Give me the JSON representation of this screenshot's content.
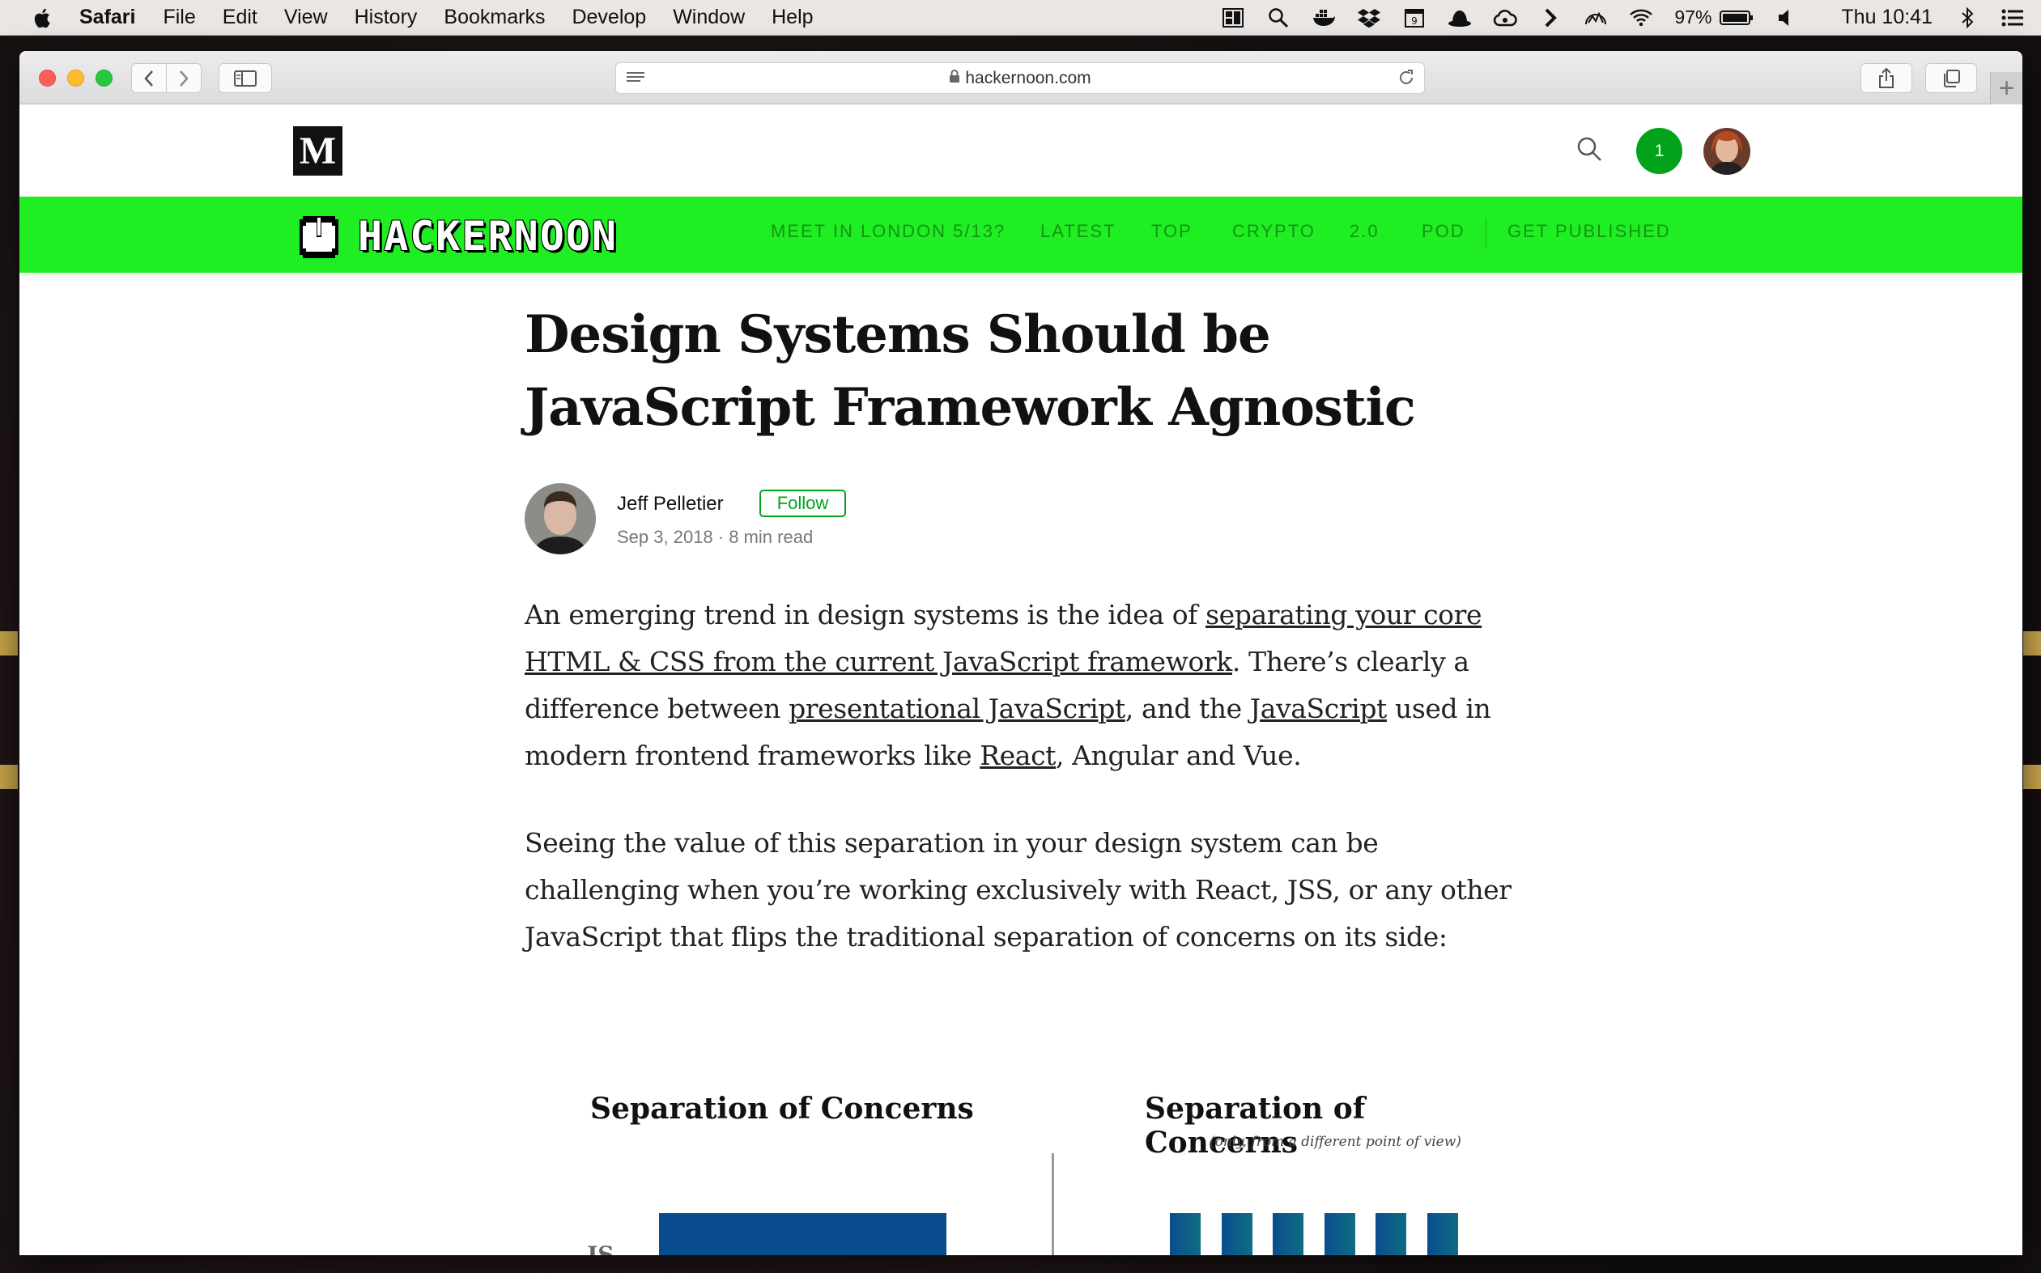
{
  "menubar": {
    "app_name": "Safari",
    "items": [
      "File",
      "Edit",
      "View",
      "History",
      "Bookmarks",
      "Develop",
      "Window",
      "Help"
    ],
    "battery": "97%",
    "clock": "Thu 10:41"
  },
  "browser": {
    "url": "hackernoon.com",
    "new_tab": "+"
  },
  "medium": {
    "logo": "M",
    "notification_count": "1"
  },
  "publication": {
    "wordmark": "HACKERNOON",
    "nav": [
      "MEET IN LONDON 5/13?",
      "LATEST",
      "TOP",
      "CRYPTO",
      "2.0",
      "POD",
      "GET PUBLISHED"
    ],
    "brand_color": "#1fee22"
  },
  "article": {
    "title": "Design Systems Should be JavaScript Framework Agnostic",
    "author": "Jeff Pelletier",
    "follow_label": "Follow",
    "date": "Sep 3, 2018",
    "separator": "·",
    "read_time": "8 min read",
    "p1": {
      "t1": "An emerging trend in design systems is the idea of ",
      "l1": "separating your core HTML & CSS from the current JavaScript framework",
      "t2": ". There’s clearly a difference between ",
      "l2": "presentational JavaScript",
      "t3": ", and the ",
      "l3": "JavaScript",
      "t4": " used in modern frontend frameworks like ",
      "l4": "React",
      "t5": ", Angular and Vue."
    },
    "p2": "Seeing the value of this separation in your design system can be challenging when you’re working exclusively with React, JSS, or any other JavaScript that flips the traditional separation of concerns on its side:"
  },
  "figure": {
    "left_title": "Separation of Concerns",
    "right_title": "Separation of Concerns",
    "right_subtitle": "(only, from a different point of view)",
    "row_label": "JS"
  }
}
